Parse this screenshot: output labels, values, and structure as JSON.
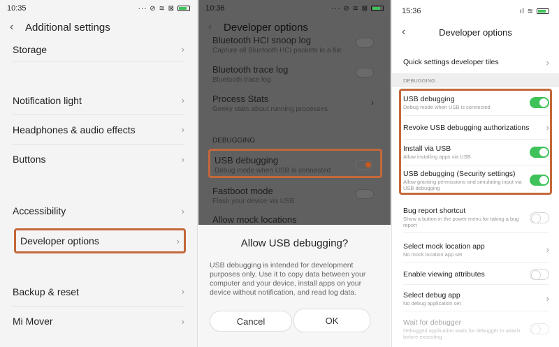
{
  "panel1": {
    "time": "10:35",
    "status_icons": "··· ⊘ ≋ ⊠",
    "back_icon": "chevron-left-icon",
    "title": "Additional settings",
    "items": [
      {
        "label": "Storage"
      },
      {
        "label": "Notification light"
      },
      {
        "label": "Headphones & audio effects"
      },
      {
        "label": "Buttons"
      },
      {
        "label": "Accessibility"
      },
      {
        "label": "Developer options",
        "highlighted": true
      },
      {
        "label": "Backup & reset"
      },
      {
        "label": "Mi Mover"
      }
    ]
  },
  "panel2": {
    "time": "10:36",
    "status_icons": "··· ⊘ ≋ ⊠",
    "title": "Developer options",
    "items": [
      {
        "label": "Bluetooth HCI snoop log",
        "sub": "Capture all Bluetooth HCI packets in a file"
      },
      {
        "label": "Bluetooth trace log",
        "sub": "Bluetooth trace log"
      },
      {
        "label": "Process Stats",
        "sub": "Geeky stats about running processes"
      }
    ],
    "section": "DEBUGGING",
    "usb": {
      "label": "USB debugging",
      "sub": "Debug mode when USB is connected",
      "enabled": true
    },
    "items2": [
      {
        "label": "Fastboot mode",
        "sub": "Flash your device via USB"
      },
      {
        "label": "Allow mock locations"
      }
    ],
    "dialog": {
      "title": "Allow USB debugging?",
      "body": "USB debugging is intended for development purposes only. Use it to copy data between your computer and your device, install apps on your device without notification, and read log data.",
      "cancel": "Cancel",
      "ok": "OK"
    }
  },
  "panel3": {
    "time": "15:36",
    "status_icons": "ıl ≋",
    "title": "Developer options",
    "quick_tiles": "Quick settings developer tiles",
    "section": "DEBUGGING",
    "items": [
      {
        "label": "USB debugging",
        "sub": "Debug mode when USB is connected",
        "control": "switch",
        "on": true
      },
      {
        "label": "Revoke USB debugging authorizations",
        "sub": "",
        "control": "chevron"
      },
      {
        "label": "Install via USB",
        "sub": "Allow installing apps via USB",
        "control": "switch",
        "on": true
      },
      {
        "label": "USB debugging (Security settings)",
        "sub": "Allow granting permissions and simulating input via USB debugging",
        "control": "switch",
        "on": true
      },
      {
        "label": "Bug report shortcut",
        "sub": "Show a button in the power menu for taking a bug report",
        "control": "switch",
        "on": false
      },
      {
        "label": "Select mock location app",
        "sub": "No mock location app set",
        "control": "chevron"
      },
      {
        "label": "Enable viewing attributes",
        "sub": "",
        "control": "switch",
        "on": false
      },
      {
        "label": "Select debug app",
        "sub": "No debug application set",
        "control": "chevron"
      },
      {
        "label": "Wait for debugger",
        "sub": "Debugged application waits for debugger to attach before executing",
        "control": "switch",
        "on": false,
        "disabled": true
      }
    ]
  },
  "colors": {
    "highlight": "#c3683a",
    "switch_on": "#3ec25a",
    "toggle_orange": "#c45a21"
  }
}
